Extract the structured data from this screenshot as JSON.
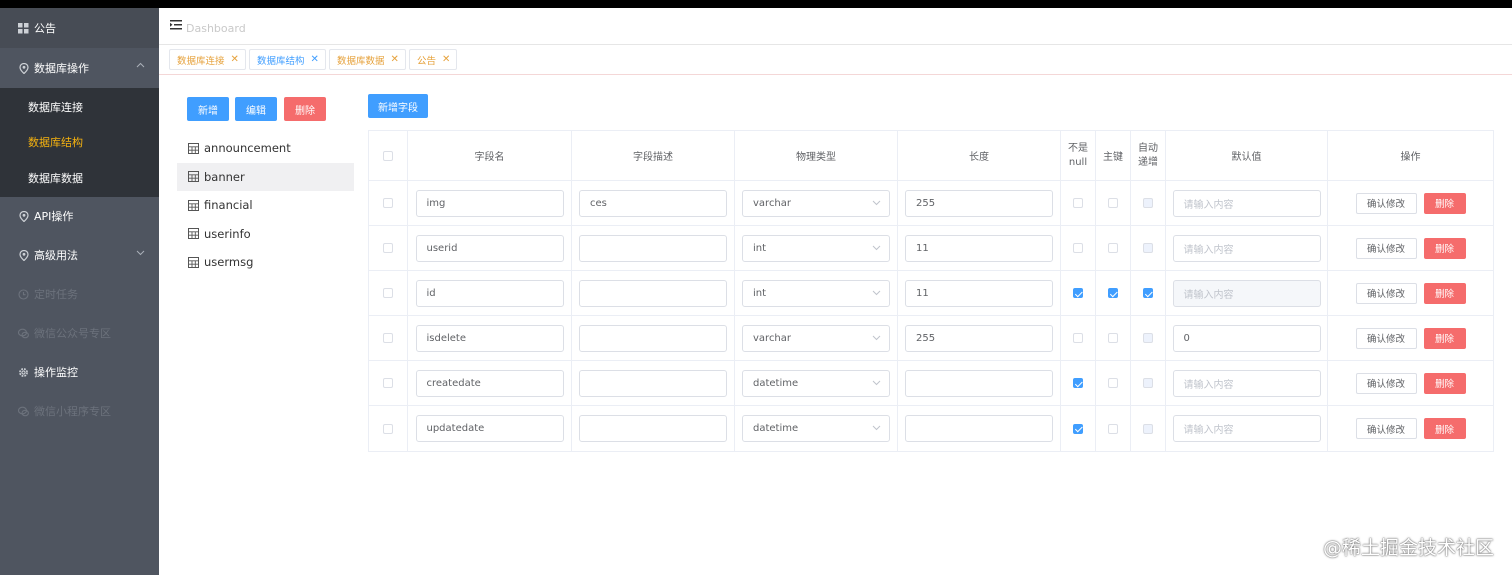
{
  "sidebar": {
    "top": {
      "label": "公告",
      "icon": "grid-icon"
    },
    "db_ops": {
      "label": "数据库操作",
      "icon": "location-icon",
      "children": [
        "数据库连接",
        "数据库结构",
        "数据库数据"
      ]
    },
    "items": [
      {
        "label": "API操作",
        "icon": "location-icon",
        "dim": false,
        "chevron": false
      },
      {
        "label": "高级用法",
        "icon": "location-icon",
        "dim": false,
        "chevron": true
      },
      {
        "label": "定时任务",
        "icon": "clock-icon",
        "dim": true,
        "chevron": false
      },
      {
        "label": "微信公众号专区",
        "icon": "wechat-icon",
        "dim": true,
        "chevron": false
      },
      {
        "label": "操作监控",
        "icon": "gear-icon",
        "dim": false,
        "chevron": false
      },
      {
        "label": "微信小程序专区",
        "icon": "wechat-icon",
        "dim": true,
        "chevron": false
      }
    ]
  },
  "header": {
    "breadcrumb": "Dashboard"
  },
  "tabs": [
    "数据库连接",
    "数据库结构",
    "数据库数据",
    "公告"
  ],
  "left": {
    "buttons": {
      "add": "新增",
      "edit": "编辑",
      "delete": "删除"
    },
    "tables": [
      "announcement",
      "banner",
      "financial",
      "userinfo",
      "usermsg"
    ]
  },
  "add_field_label": "新增字段",
  "columns": {
    "name": "字段名",
    "desc": "字段描述",
    "type": "物理类型",
    "length": "长度",
    "not_null": "不是null",
    "pk": "主键",
    "ai": "自动递增",
    "default": "默认值",
    "op": "操作"
  },
  "default_placeholder": "请输入内容",
  "confirm_label": "确认修改",
  "delete_label": "删除",
  "rows": [
    {
      "name": "img",
      "desc": "ces",
      "type": "varchar",
      "length": "255",
      "not_null": false,
      "pk": false,
      "ai": false,
      "ai_disabled": true,
      "default": ""
    },
    {
      "name": "userid",
      "desc": "",
      "type": "int",
      "length": "11",
      "not_null": false,
      "pk": false,
      "ai": false,
      "ai_disabled": true,
      "default": ""
    },
    {
      "name": "id",
      "desc": "",
      "type": "int",
      "length": "11",
      "not_null": true,
      "pk": true,
      "ai": true,
      "ai_disabled": false,
      "default": "",
      "default_disabled": true
    },
    {
      "name": "isdelete",
      "desc": "",
      "type": "varchar",
      "length": "255",
      "not_null": false,
      "pk": false,
      "ai": false,
      "ai_disabled": true,
      "default": "0"
    },
    {
      "name": "createdate",
      "desc": "",
      "type": "datetime",
      "length": "",
      "not_null": true,
      "pk": false,
      "ai": false,
      "ai_disabled": true,
      "default": ""
    },
    {
      "name": "updatedate",
      "desc": "",
      "type": "datetime",
      "length": "",
      "not_null": true,
      "pk": false,
      "ai": false,
      "ai_disabled": true,
      "default": ""
    }
  ],
  "watermark": "@稀土掘金技术社区"
}
